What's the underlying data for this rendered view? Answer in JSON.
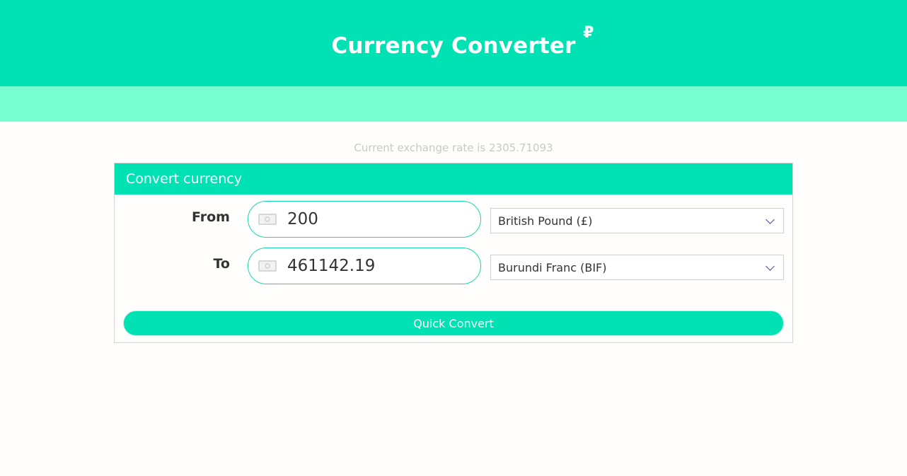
{
  "header": {
    "title": "Currency Converter",
    "symbol": "₽"
  },
  "rate_text": "Current exchange rate is 2305.71093",
  "panel": {
    "heading": "Convert currency",
    "from": {
      "label": "From",
      "amount": "200",
      "currency": "British Pound (£)"
    },
    "to": {
      "label": "To",
      "amount": "461142.19",
      "currency": "Burundi Franc (BIF)"
    },
    "button": "Quick Convert"
  },
  "colors": {
    "primary": "#00e1b4",
    "band": "#77ffd2",
    "chevron": "#5b3aa8"
  },
  "icons": {
    "amount": "money-bill-icon",
    "select": "chevron-down-icon"
  }
}
